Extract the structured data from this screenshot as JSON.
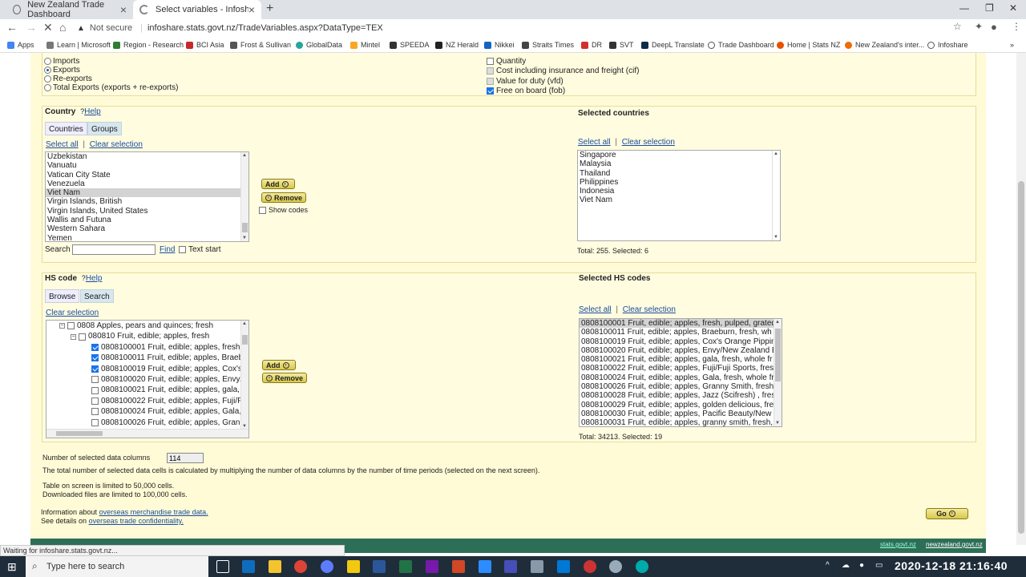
{
  "browser": {
    "tabs": [
      {
        "title": "New Zealand Trade Dashboard"
      },
      {
        "title": "Select variables - Infoshare - Stat"
      }
    ],
    "url_notice": "Not secure",
    "url": "infoshare.stats.govt.nz/TradeVariables.aspx?DataType=TEX",
    "bookmarks": [
      "Apps",
      "Learn | Microsoft",
      "Region - Research",
      "BCI Asia",
      "Frost & Sullivan",
      "GlobalData",
      "Mintel",
      "SPEEDA",
      "NZ Herald",
      "Nikkei",
      "Straits Times",
      "DR",
      "SVT",
      "DeepL Translate",
      "Trade Dashboard",
      "Home | Stats NZ",
      "New Zealand's inter...",
      "Infoshare"
    ]
  },
  "flow": {
    "options": [
      {
        "label": "Imports",
        "checked": false
      },
      {
        "label": "Exports",
        "checked": true
      },
      {
        "label": "Re-exports",
        "checked": false
      },
      {
        "label": "Total Exports (exports + re-exports)",
        "checked": false
      }
    ],
    "measures": [
      {
        "label": "Quantity",
        "state": "off"
      },
      {
        "label": "Cost including insurance and freight (cif)",
        "state": "gray"
      },
      {
        "label": "Value for duty (vfd)",
        "state": "gray"
      },
      {
        "label": "Free on board (fob)",
        "state": "on"
      }
    ]
  },
  "country": {
    "title": "Country",
    "help": "Help",
    "tabs": [
      "Countries",
      "Groups"
    ],
    "select_all": "Select all",
    "clear_selection": "Clear selection",
    "list": [
      "Uzbekistan",
      "Vanuatu",
      "Vatican City State",
      "Venezuela",
      "Viet Nam",
      "Virgin Islands, British",
      "Virgin Islands, United States",
      "Wallis and Futuna",
      "Western Sahara",
      "Yemen"
    ],
    "selected_index": 4,
    "add": "Add",
    "remove": "Remove",
    "show_codes": "Show codes",
    "search_label": "Search",
    "find": "Find",
    "text_start": "Text start",
    "selected_title": "Selected countries",
    "selected_list": [
      "Singapore",
      "Malaysia",
      "Thailand",
      "Philippines",
      "Indonesia",
      "Viet Nam"
    ],
    "total": "Total: 255. Selected: 6"
  },
  "hs": {
    "title": "HS code",
    "help": "Help",
    "tabs": [
      "Browse",
      "Search"
    ],
    "clear_selection": "Clear selection",
    "tree": [
      {
        "label": "0808 Apples, pears and quinces; fresh",
        "level": 0,
        "expander": "−",
        "checked": false
      },
      {
        "label": "080810 Fruit, edible; apples, fresh",
        "level": 1,
        "expander": "−",
        "checked": false
      },
      {
        "label": "0808100001 Fruit, edible; apples, fresh,",
        "level": 2,
        "checked": true
      },
      {
        "label": "0808100011 Fruit, edible; apples, Braeb",
        "level": 2,
        "checked": true
      },
      {
        "label": "0808100019 Fruit, edible; apples, Cox's",
        "level": 2,
        "checked": true
      },
      {
        "label": "0808100020 Fruit, edible; apples, Envy/",
        "level": 2,
        "checked": false
      },
      {
        "label": "0808100021 Fruit, edible; apples, gala,",
        "level": 2,
        "checked": false
      },
      {
        "label": "0808100022 Fruit, edible; apples, Fuji/F",
        "level": 2,
        "checked": false
      },
      {
        "label": "0808100024 Fruit, edible; apples, Gala,",
        "level": 2,
        "checked": false
      },
      {
        "label": "0808100026 Fruit, edible; apples, Grann",
        "level": 2,
        "checked": false
      }
    ],
    "add": "Add",
    "remove": "Remove",
    "selected_title": "Selected HS codes",
    "select_all": "Select all",
    "clear_selection_right": "Clear selection",
    "selected_list": [
      "0808100001 Fruit, edible; apples, fresh, pulped, grated",
      "0808100011 Fruit, edible; apples, Braeburn, fresh, wh",
      "0808100019 Fruit, edible; apples, Cox's Orange Pippin",
      "0808100020 Fruit, edible; apples, Envy/New Zealand E",
      "0808100021 Fruit, edible; apples, gala, fresh, whole fr",
      "0808100022 Fruit, edible; apples, Fuji/Fuji Sports, fres",
      "0808100024 Fruit, edible; apples, Gala, fresh, whole fr",
      "0808100026 Fruit, edible; apples, Granny Smith, fresh",
      "0808100028 Fruit, edible; apples, Jazz (Scifresh) , fres",
      "0808100029 Fruit, edible; apples, golden delicious, fre",
      "0808100030 Fruit, edible; apples, Pacific Beauty/New Z",
      "0808100031 Fruit, edible; apples, granny smith, fresh,"
    ],
    "total": "Total: 34213. Selected: 19"
  },
  "summary": {
    "columns_label": "Number of selected data columns",
    "columns_value": "114",
    "note": "The total number of selected data cells is calculated by multiplying the number of data columns by the number of time periods (selected on the next screen).",
    "limit1": "Table on screen is limited to 50,000 cells.",
    "limit2": "Downloaded files are limited to 100,000 cells.",
    "info_prefix": "Information about",
    "info_link": "overseas merchandise trade data.",
    "details_prefix": "See details on",
    "details_link": "overseas trade confidentiality.",
    "go": "Go"
  },
  "footer": {
    "left": "stats.govt.nz",
    "right": "newzealand.govt.nz"
  },
  "status": "Waiting for infoshare.stats.govt.nz...",
  "taskbar": {
    "search_placeholder": "Type here to search",
    "clock": "2020-12-18 21:16:40"
  }
}
